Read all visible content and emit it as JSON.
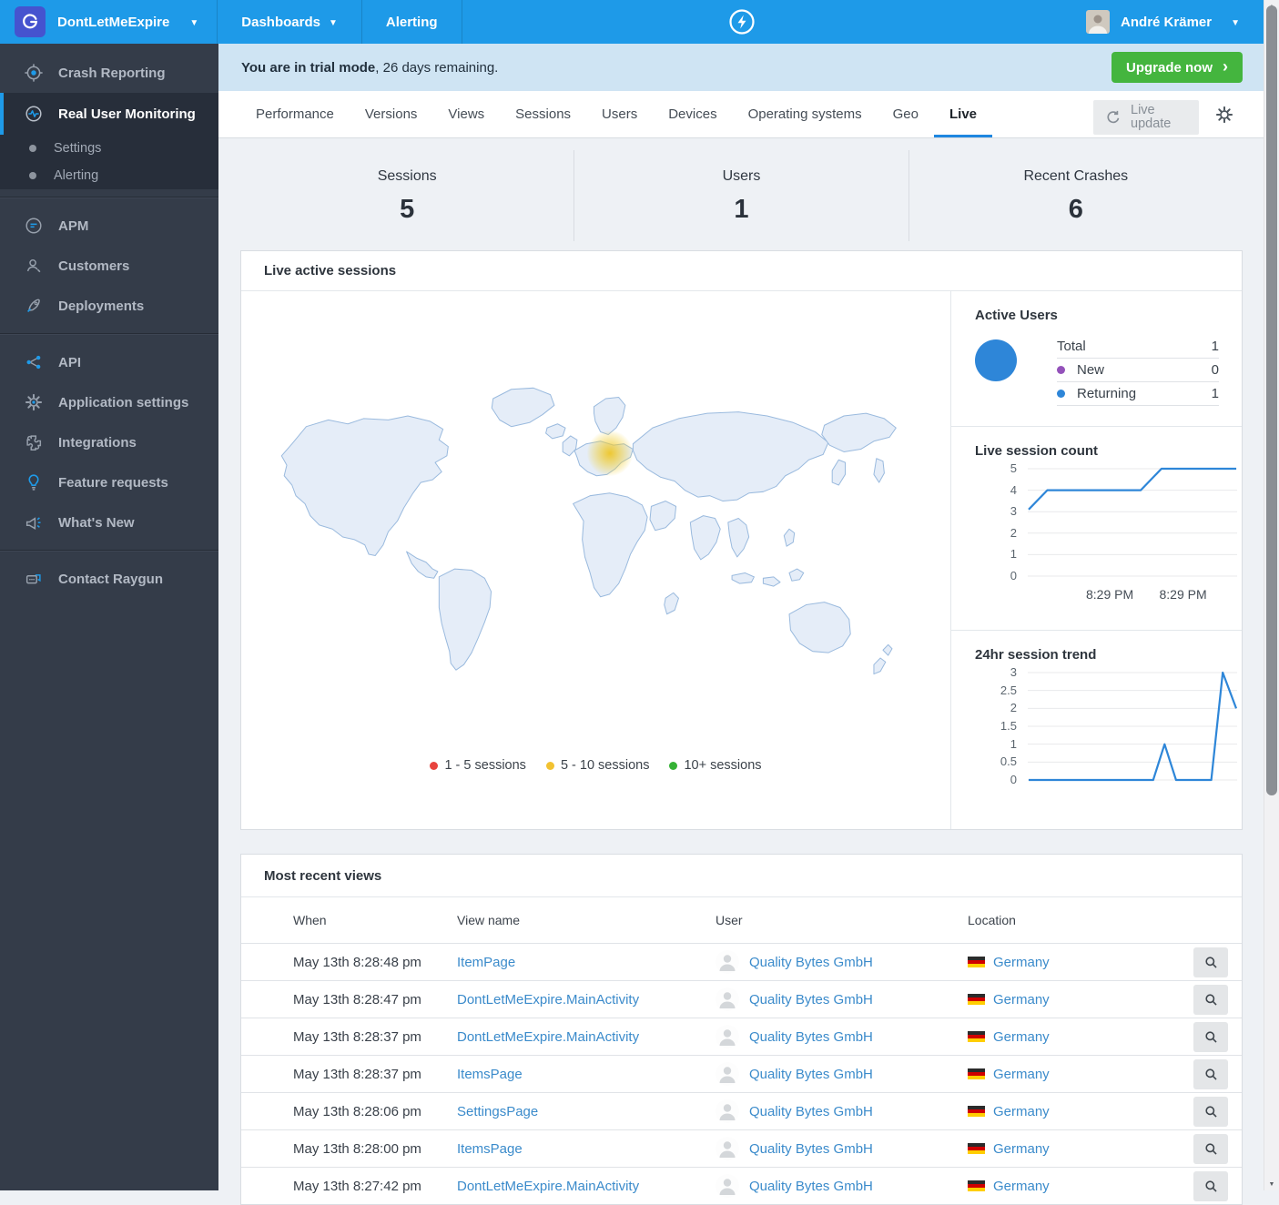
{
  "topnav": {
    "app_name": "DontLetMeExpire",
    "menu_dashboards": "Dashboards",
    "menu_alerting": "Alerting",
    "user_name": "André Krämer"
  },
  "sidebar": {
    "items": [
      {
        "id": "crash-reporting",
        "label": "Crash Reporting",
        "icon": "crosshair-icon"
      },
      {
        "id": "real-user-monitoring",
        "label": "Real User Monitoring",
        "icon": "pulse-icon",
        "active": true
      },
      {
        "id": "rum-settings",
        "label": "Settings",
        "sub": true
      },
      {
        "id": "rum-alerting",
        "label": "Alerting",
        "sub": true
      },
      {
        "divider": true
      },
      {
        "id": "apm",
        "label": "APM",
        "icon": "apm-icon"
      },
      {
        "id": "customers",
        "label": "Customers",
        "icon": "customer-search-icon"
      },
      {
        "id": "deployments",
        "label": "Deployments",
        "icon": "rocket-icon"
      },
      {
        "divider": true
      },
      {
        "id": "api",
        "label": "API",
        "icon": "api-nodes-icon"
      },
      {
        "id": "application-settings",
        "label": "Application settings",
        "icon": "gear-icon"
      },
      {
        "id": "integrations",
        "label": "Integrations",
        "icon": "puzzle-icon"
      },
      {
        "id": "feature-requests",
        "label": "Feature requests",
        "icon": "lightbulb-icon"
      },
      {
        "id": "whats-new",
        "label": "What's New",
        "icon": "megaphone-icon"
      },
      {
        "divider": true
      },
      {
        "id": "contact-raygun",
        "label": "Contact Raygun",
        "icon": "chat-icon"
      }
    ]
  },
  "banner": {
    "bold_text": "You are in trial mode",
    "rest_text": ", 26 days remaining.",
    "upgrade_label": "Upgrade now",
    "chevron": "›"
  },
  "tabbar": {
    "tabs": [
      {
        "label": "Performance"
      },
      {
        "label": "Versions"
      },
      {
        "label": "Views"
      },
      {
        "label": "Sessions"
      },
      {
        "label": "Users"
      },
      {
        "label": "Devices"
      },
      {
        "label": "Operating systems"
      },
      {
        "label": "Geo"
      },
      {
        "label": "Live",
        "active": true
      }
    ],
    "live_update_label": "Live update"
  },
  "stats": [
    {
      "label": "Sessions",
      "value": "5"
    },
    {
      "label": "Users",
      "value": "1"
    },
    {
      "label": "Recent Crashes",
      "value": "6"
    }
  ],
  "live_panel": {
    "title": "Live active sessions",
    "legend": [
      {
        "label": "1 - 5 sessions",
        "color": "#e8433e"
      },
      {
        "label": "5 - 10 sessions",
        "color": "#f2c231"
      },
      {
        "label": "10+ sessions",
        "color": "#35b235"
      }
    ]
  },
  "active_users": {
    "title": "Active Users",
    "total_label": "Total",
    "total_value": "1",
    "donut_color": "#2e86d8",
    "rows": [
      {
        "label": "New",
        "value": "0",
        "color": "#9452ba"
      },
      {
        "label": "Returning",
        "value": "1",
        "color": "#2e86d8"
      }
    ]
  },
  "chart_data": [
    {
      "name": "live-session-count",
      "type": "line",
      "title": "Live session count",
      "ylim": [
        0,
        5
      ],
      "y_ticks": [
        "5",
        "4",
        "3",
        "2",
        "1",
        "0"
      ],
      "x_labels": [
        "8:29 PM",
        "8:29 PM"
      ],
      "x_label_positions": [
        0.4,
        0.75
      ],
      "points": [
        [
          0,
          3.1
        ],
        [
          0.09,
          4
        ],
        [
          0.54,
          4
        ],
        [
          0.64,
          5
        ],
        [
          1,
          5
        ]
      ],
      "line_color": "#2e86d8",
      "grid": true,
      "legend_position": "none"
    },
    {
      "name": "24hr-session-trend",
      "type": "line",
      "title": "24hr session trend",
      "ylim": [
        0,
        3
      ],
      "y_ticks": [
        "3",
        "2.5",
        "2",
        "1.5",
        "1",
        "0.5",
        "0"
      ],
      "x_labels": [],
      "x_label_positions": [],
      "points": [
        [
          0,
          0
        ],
        [
          0.6,
          0
        ],
        [
          0.655,
          1
        ],
        [
          0.71,
          0
        ],
        [
          0.88,
          0
        ],
        [
          0.935,
          3
        ],
        [
          1,
          2
        ]
      ],
      "line_color": "#2e86d8",
      "grid": true,
      "legend_position": "none"
    }
  ],
  "recent_views": {
    "title": "Most recent views",
    "columns": [
      "When",
      "View name",
      "User",
      "Location"
    ],
    "rows": [
      {
        "when": "May 13th 8:28:48 pm",
        "view": "ItemPage",
        "user": "Quality Bytes GmbH",
        "location": "Germany"
      },
      {
        "when": "May 13th 8:28:47 pm",
        "view": "DontLetMeExpire.MainActivity",
        "user": "Quality Bytes GmbH",
        "location": "Germany"
      },
      {
        "when": "May 13th 8:28:37 pm",
        "view": "DontLetMeExpire.MainActivity",
        "user": "Quality Bytes GmbH",
        "location": "Germany"
      },
      {
        "when": "May 13th 8:28:37 pm",
        "view": "ItemsPage",
        "user": "Quality Bytes GmbH",
        "location": "Germany"
      },
      {
        "when": "May 13th 8:28:06 pm",
        "view": "SettingsPage",
        "user": "Quality Bytes GmbH",
        "location": "Germany"
      },
      {
        "when": "May 13th 8:28:00 pm",
        "view": "ItemsPage",
        "user": "Quality Bytes GmbH",
        "location": "Germany"
      },
      {
        "when": "May 13th 8:27:42 pm",
        "view": "DontLetMeExpire.MainActivity",
        "user": "Quality Bytes GmbH",
        "location": "Germany"
      }
    ]
  },
  "colors": {
    "navbar": "#1e9ae8",
    "sidebar": "#343c49",
    "banner_bg": "#cfe4f3",
    "upgrade_green": "#44b53e",
    "link_blue": "#3b8bcb",
    "chart_line": "#2e86d8",
    "map_fill": "#e5edf8",
    "map_stroke": "#9abade"
  }
}
